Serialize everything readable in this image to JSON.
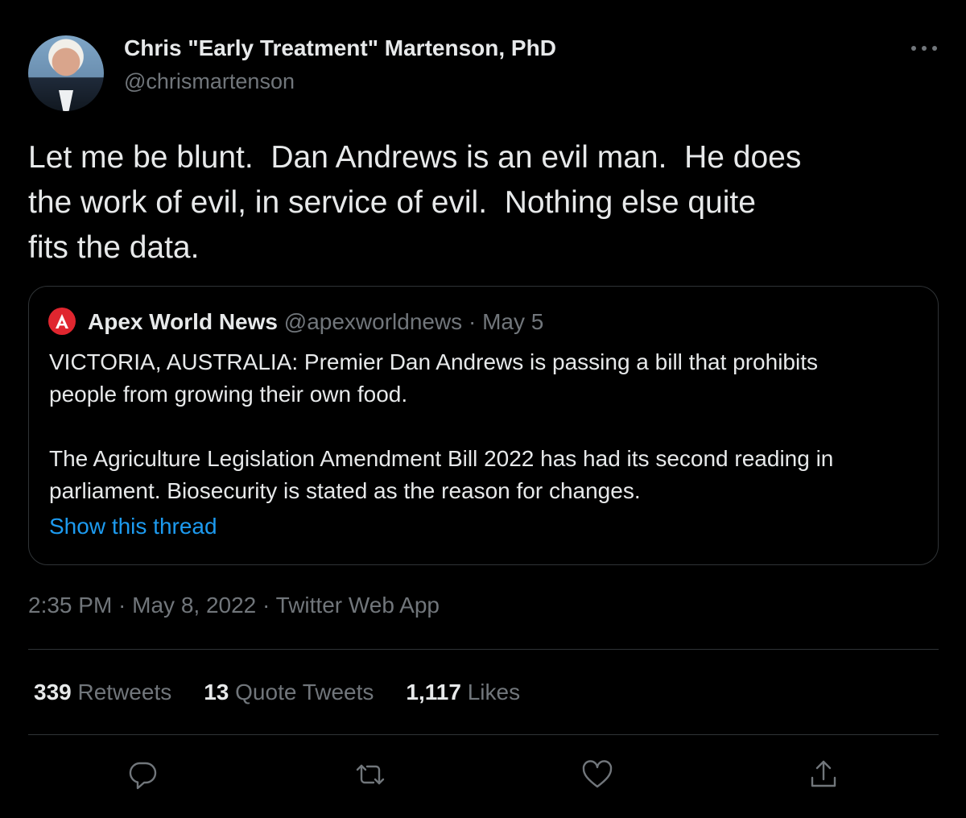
{
  "author": {
    "name": "Chris \"Early Treatment\" Martenson, PhD",
    "handle": "@chrismartenson"
  },
  "tweet": {
    "text": "Let me be blunt.  Dan Andrews is an evil man.  He does\nthe work of evil, in service of evil.  Nothing else quite\nfits the data."
  },
  "quoted": {
    "name": "Apex World News",
    "handle": "@apexworldnews",
    "separator": " · ",
    "date": "May 5",
    "body": "VICTORIA, AUSTRALIA: Premier Dan Andrews is passing a bill that prohibits\npeople from growing their own food.\n\nThe Agriculture Legislation Amendment Bill 2022 has had its second reading in\nparliament. Biosecurity is stated as the reason for changes.",
    "show_thread": "Show this thread",
    "logo_letter": "A"
  },
  "meta": {
    "text": "2:35 PM · May 8, 2022 · Twitter Web App"
  },
  "stats": {
    "retweets_count": "339",
    "retweets_label": "Retweets",
    "quotes_count": "13",
    "quotes_label": "Quote Tweets",
    "likes_count": "1,117",
    "likes_label": "Likes"
  },
  "icons": {
    "reply": "reply-icon",
    "retweet": "retweet-icon",
    "like": "heart-icon",
    "share": "share-icon",
    "more": "more-icon"
  },
  "colors": {
    "background": "#000000",
    "text": "#e7e9ea",
    "secondary": "#71767b",
    "link": "#1d9bf0",
    "border": "#2f3336",
    "apex_red": "#e0262f"
  }
}
